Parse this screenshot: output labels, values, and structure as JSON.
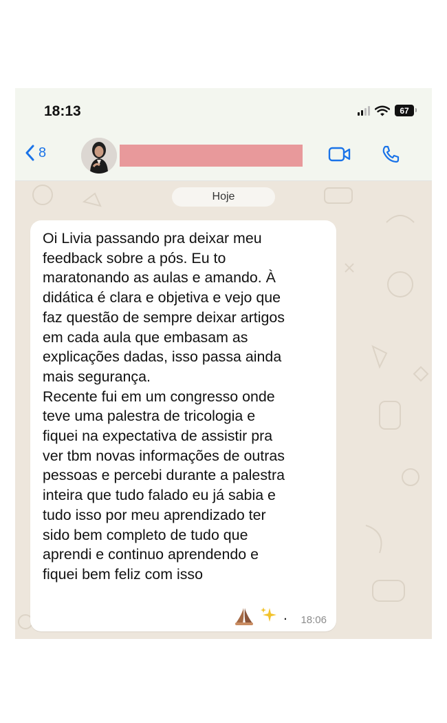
{
  "status": {
    "time": "18:13",
    "battery": "67"
  },
  "header": {
    "back_count": "8"
  },
  "chat": {
    "date_chip": "Hoje",
    "message": {
      "text": "Oi Livia passando pra deixar meu\nfeedback sobre a pós. Eu to\nmaratonando as aulas e amando. À\ndidática é clara e objetiva e vejo que\nfaz questão de sempre deixar artigos\nem cada aula que embasam as\nexplicações dadas, isso passa ainda\nmais segurança.\nRecente fui em um congresso onde\nteve uma palestra de tricologia e\nfiquei na expectativa de assistir pra\nver tbm novas informações de outras\npessoas e percebi durante a palestra\ninteira que tudo falado eu já sabia e\ntudo isso por meu aprendizado ter\nsido bem completo de tudo que\naprendi e continuo aprendendo e\nfiquei bem feliz com isso",
      "trailing_period": ".",
      "time": "18:06"
    }
  },
  "colors": {
    "accent": "#1a73e8",
    "wallpaper": "#ede6dc",
    "header_bg": "#f3f6ef",
    "redaction": "#e8999b"
  }
}
